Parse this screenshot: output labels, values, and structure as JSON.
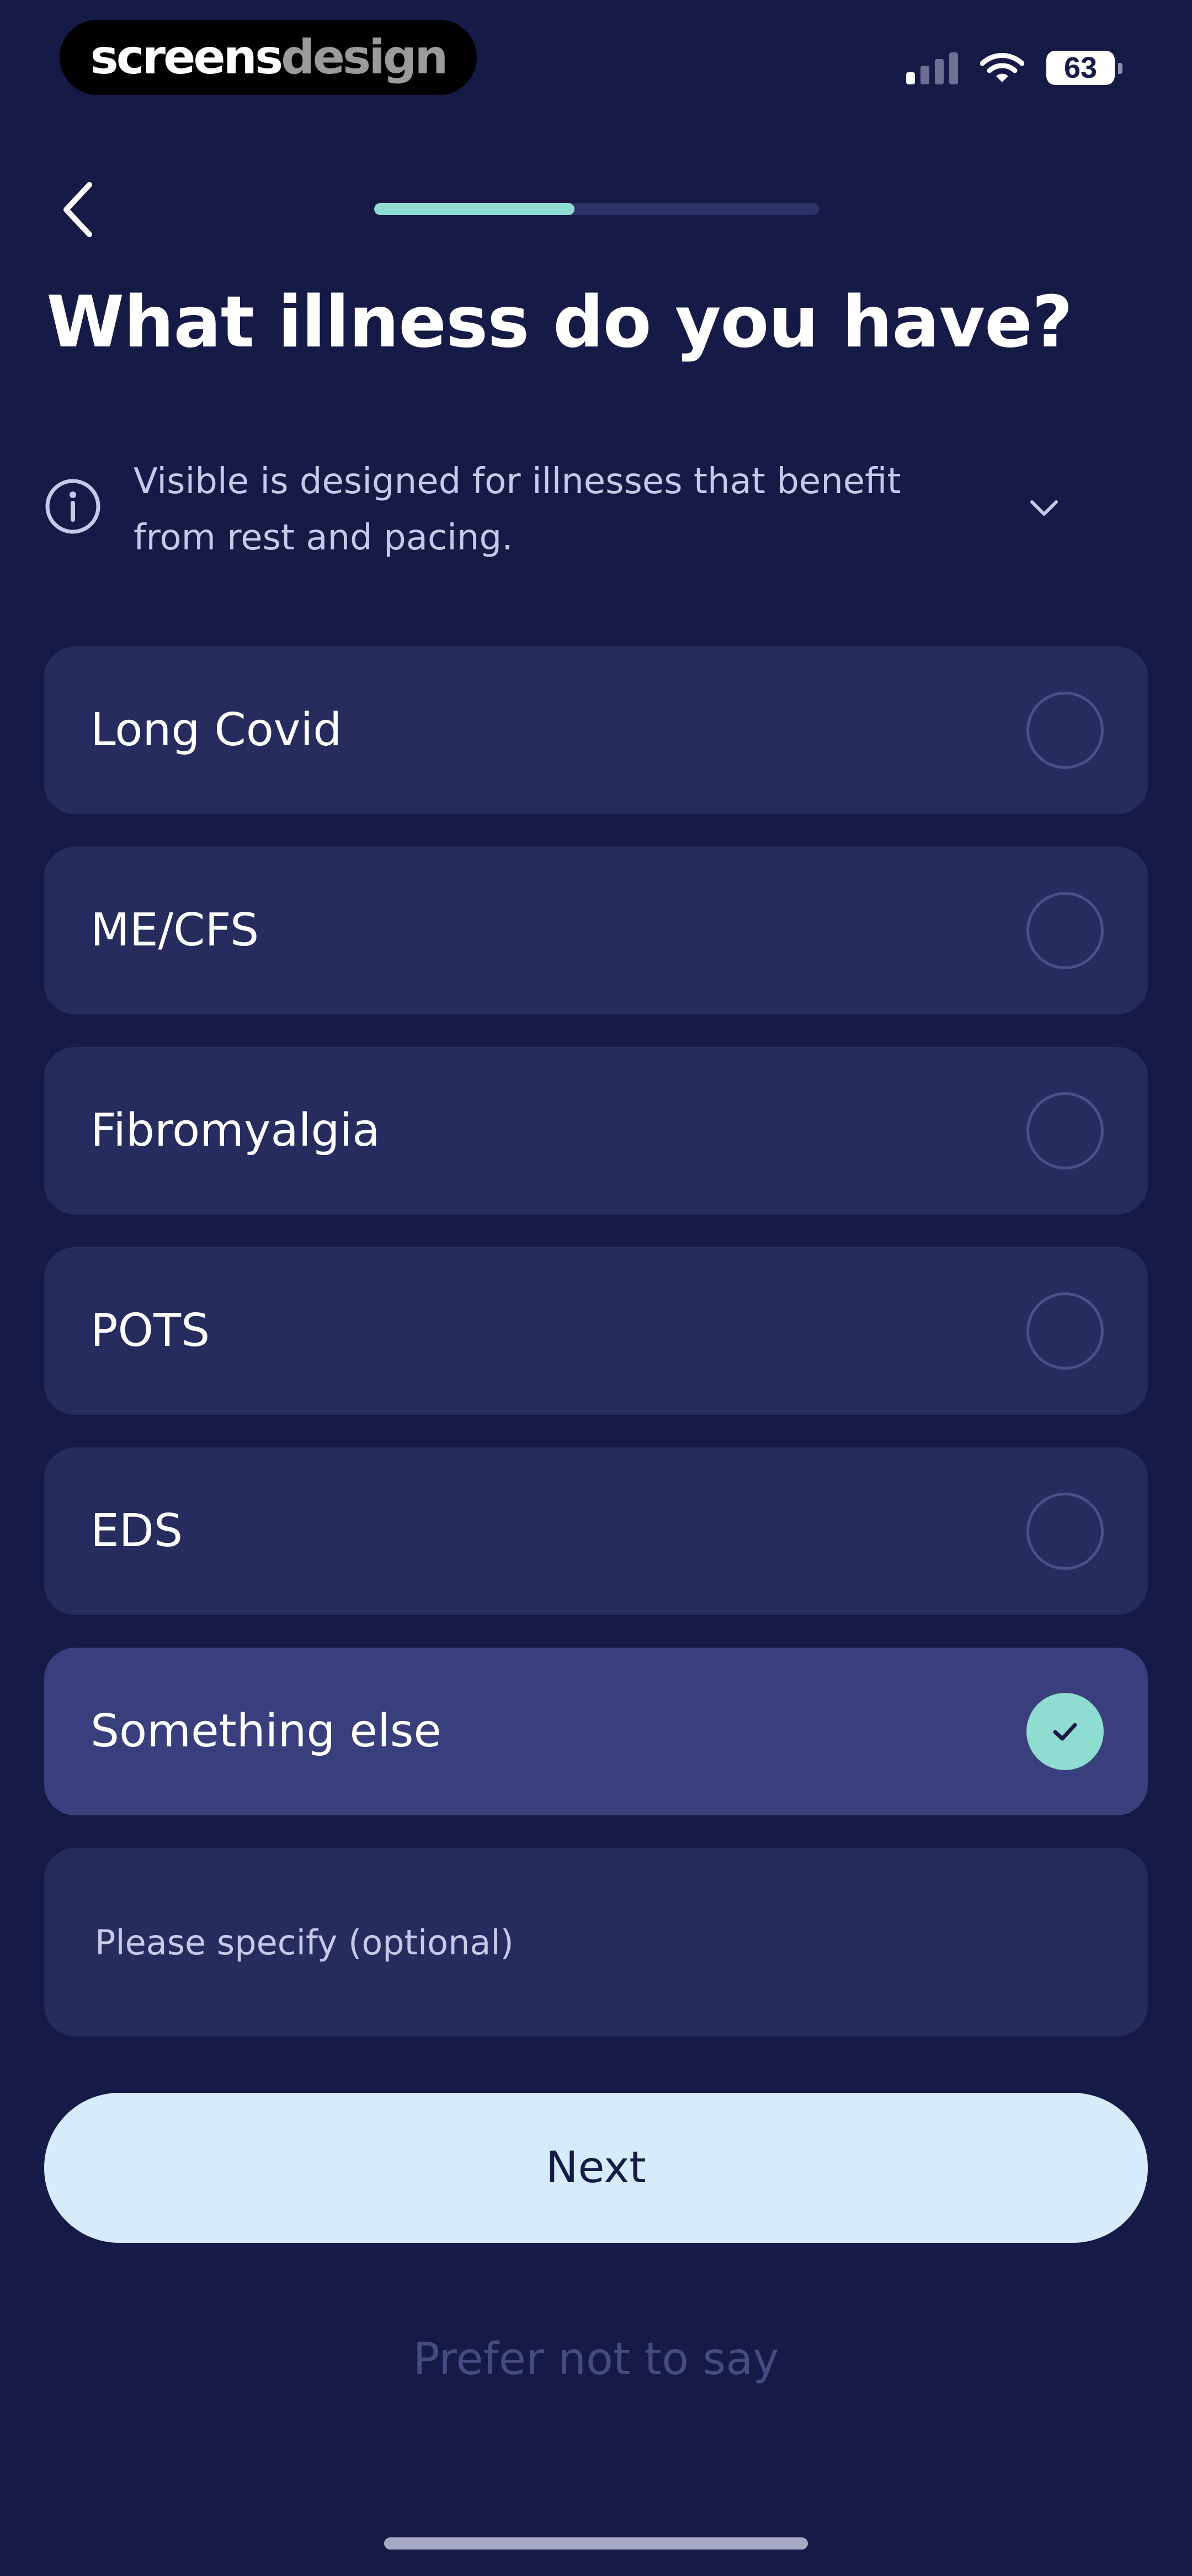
{
  "watermark": {
    "part1": "screens",
    "part2": "design"
  },
  "status_bar": {
    "battery": "63",
    "signal_bars_active": 1,
    "signal_bars_total": 4
  },
  "header": {
    "progress": 0.45,
    "back_icon": "chevron-left-icon"
  },
  "title": "What illness do you have?",
  "info": {
    "text": "Visible is designed for illnesses that benefit from rest and pacing.",
    "icon": "info-icon",
    "chevron_icon": "chevron-down-icon"
  },
  "options": [
    {
      "label": "Long Covid",
      "selected": false
    },
    {
      "label": "ME/CFS",
      "selected": false
    },
    {
      "label": "Fibromyalgia",
      "selected": false
    },
    {
      "label": "POTS",
      "selected": false
    },
    {
      "label": "EDS",
      "selected": false
    },
    {
      "label": "Something else",
      "selected": true
    }
  ],
  "specify": {
    "placeholder": "Please specify (optional)",
    "value": ""
  },
  "next_label": "Next",
  "prefer_label": "Prefer not to say",
  "colors": {
    "background": "#161a47",
    "option_bg": "#272c5e",
    "option_selected_bg": "#393f7c",
    "accent": "#8fdcd0",
    "button_bg": "#d6ebfb"
  }
}
